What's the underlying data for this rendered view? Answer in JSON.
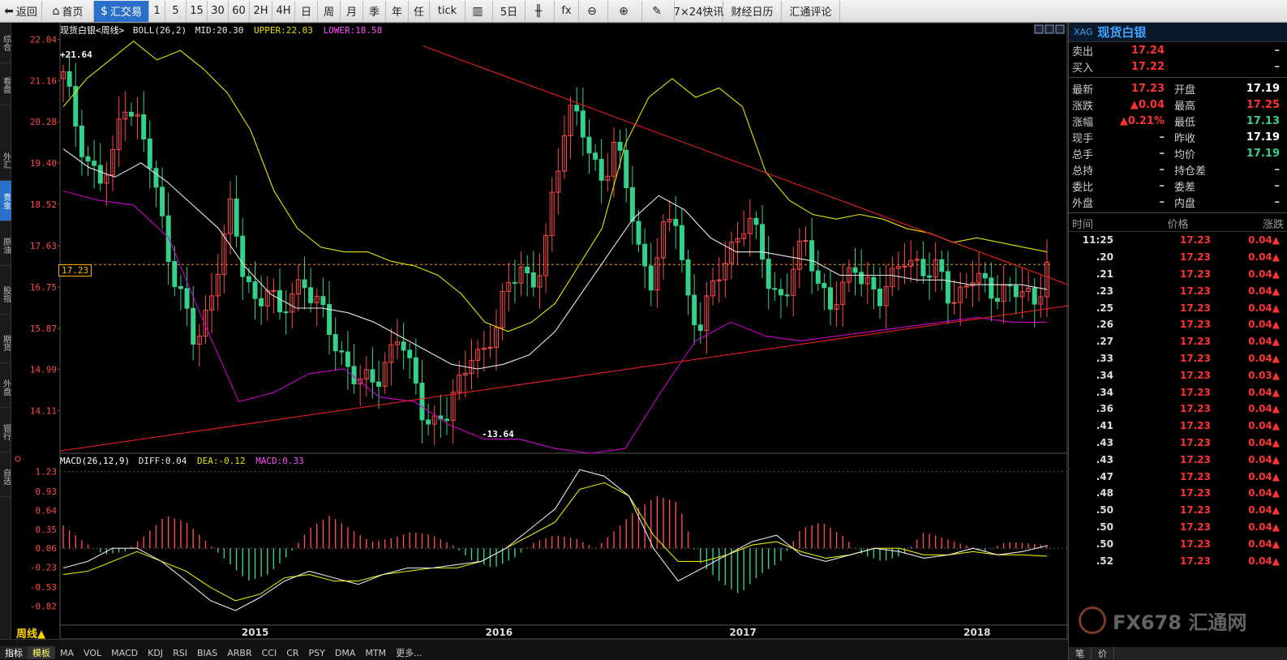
{
  "toolbar": {
    "items": [
      "返回",
      "首页",
      "汇交易",
      "1",
      "5",
      "15",
      "30",
      "60",
      "2H",
      "4H",
      "日",
      "周",
      "月",
      "季",
      "年",
      "任",
      "tick",
      "",
      "5日",
      "",
      "fx",
      "",
      "",
      "",
      "7×24快讯",
      "财经日历",
      "汇通评论"
    ]
  },
  "left_tabs": [
    "综合",
    "看盘",
    "外汇",
    "贵金",
    "原油",
    "股指",
    "期货",
    "外盘",
    "银行",
    "自选"
  ],
  "chart": {
    "title": "现货白银<周线>",
    "boll_label": "BOLL(26,2)",
    "mid_label": "MID:20.30",
    "upper_label": "UPPER:22.03",
    "lower_label": "LOWER:18.58",
    "macd_label": "MACD(26,12,9)",
    "diff_label": "DIFF:0.04",
    "dea_label": "DEA:-0.12",
    "macdv_label": "MACD:0.33",
    "high_mark": "+21.64",
    "low_mark": "-13.64",
    "current_price_tag": "17.23",
    "period": "周线▲"
  },
  "chart_data": {
    "type": "candlestick",
    "price_axis": [
      22.04,
      21.16,
      20.28,
      19.4,
      18.52,
      17.63,
      16.75,
      15.87,
      14.99,
      14.11
    ],
    "macd_axis": [
      1.23,
      0.93,
      0.64,
      0.35,
      0.06,
      -0.23,
      -0.53,
      -0.82
    ],
    "x_labels": [
      "2015",
      "2016",
      "2017",
      "2018"
    ],
    "price_ylim": [
      13.2,
      22.1
    ],
    "macd_ylim": [
      -1.1,
      1.3
    ],
    "close_trend": [
      21.2,
      20.3,
      19.5,
      19.0,
      19.2,
      20.9,
      20.4,
      19.6,
      18.4,
      17.3,
      16.4,
      15.4,
      16.2,
      17.5,
      18.4,
      17.0,
      16.5,
      16.8,
      16.0,
      16.6,
      17.0,
      16.4,
      15.9,
      15.4,
      15.0,
      14.6,
      14.7,
      15.3,
      15.8,
      14.8,
      14.1,
      13.9,
      14.0,
      14.6,
      15.5,
      15.3,
      15.7,
      16.8,
      17.4,
      16.6,
      17.2,
      19.2,
      20.5,
      20.3,
      19.4,
      19.2,
      19.8,
      18.8,
      17.5,
      17.0,
      17.8,
      18.3,
      16.6,
      15.9,
      16.5,
      17.3,
      17.8,
      18.2,
      17.6,
      16.8,
      16.5,
      17.2,
      17.7,
      16.9,
      16.3,
      16.6,
      17.3,
      16.9,
      16.4,
      16.8,
      17.6,
      17.2,
      16.9,
      17.2,
      16.6,
      16.5,
      17.0,
      16.8,
      16.7,
      16.5,
      16.7,
      16.5,
      17.23
    ],
    "upper_band": [
      20.6,
      21.2,
      21.6,
      22.0,
      21.6,
      21.8,
      21.4,
      20.9,
      20.1,
      18.8,
      18.0,
      17.6,
      17.5,
      17.5,
      17.3,
      17.2,
      17.0,
      16.6,
      16.0,
      15.8,
      16.0,
      16.4,
      17.2,
      18.0,
      19.8,
      20.8,
      21.2,
      20.8,
      21.0,
      20.6,
      19.2,
      18.6,
      18.3,
      18.2,
      18.3,
      18.2,
      18.0,
      17.9,
      17.7,
      17.8,
      17.7,
      17.6,
      17.5
    ],
    "mid_band": [
      19.7,
      19.3,
      19.1,
      19.4,
      19.0,
      18.5,
      18.0,
      17.2,
      16.6,
      16.3,
      16.3,
      16.2,
      16.0,
      15.7,
      15.4,
      15.1,
      15.0,
      15.1,
      15.3,
      15.8,
      16.6,
      17.4,
      18.2,
      18.7,
      18.4,
      17.8,
      17.5,
      17.5,
      17.4,
      17.3,
      17.0,
      17.0,
      17.0,
      16.9,
      16.9,
      16.8,
      16.8,
      16.8,
      16.7
    ],
    "lower_band": [
      18.8,
      18.6,
      18.5,
      17.8,
      16.0,
      14.3,
      14.5,
      14.9,
      15.0,
      14.4,
      14.3,
      13.8,
      13.5,
      13.5,
      13.3,
      13.2,
      13.3,
      14.5,
      15.6,
      16.0,
      15.7,
      15.6,
      15.7,
      15.8,
      15.9,
      16.0,
      16.1,
      16.0,
      16.0
    ],
    "trend_line_upper": {
      "from": [
        0.36,
        21.9
      ],
      "to": [
        1.0,
        16.8
      ]
    },
    "trend_line_lower": {
      "from": [
        0.0,
        13.25
      ],
      "to": [
        1.0,
        16.35
      ]
    },
    "macd_hist": [
      0.35,
      0.1,
      -0.1,
      -0.05,
      0.2,
      0.5,
      0.4,
      0.1,
      -0.2,
      -0.5,
      -0.4,
      -0.1,
      0.3,
      0.5,
      0.3,
      0.1,
      0.15,
      0.25,
      0.2,
      0.05,
      -0.2,
      -0.3,
      -0.15,
      0.1,
      0.2,
      0.15,
      0.0,
      0.3,
      0.6,
      0.8,
      0.7,
      -0.2,
      -0.5,
      -0.7,
      -0.4,
      -0.2,
      0.3,
      0.4,
      0.2,
      -0.1,
      -0.2,
      -0.1,
      0.25,
      0.15,
      0.05,
      -0.05,
      0.1,
      0.08,
      0.05
    ],
    "diff_line": [
      -0.3,
      -0.2,
      0.0,
      0.0,
      -0.2,
      -0.5,
      -0.8,
      -0.95,
      -0.75,
      -0.5,
      -0.35,
      -0.45,
      -0.55,
      -0.4,
      -0.3,
      -0.3,
      -0.25,
      -0.2,
      0.0,
      0.3,
      0.6,
      1.2,
      1.1,
      0.8,
      0.0,
      -0.5,
      -0.3,
      -0.1,
      0.1,
      0.2,
      -0.1,
      -0.2,
      -0.1,
      0.0,
      -0.05,
      -0.15,
      -0.1,
      0.0,
      -0.1,
      -0.05,
      0.04
    ],
    "dea_line": [
      -0.4,
      -0.35,
      -0.2,
      -0.05,
      -0.2,
      -0.35,
      -0.6,
      -0.8,
      -0.7,
      -0.45,
      -0.4,
      -0.5,
      -0.5,
      -0.4,
      -0.35,
      -0.3,
      -0.3,
      -0.2,
      0.0,
      0.2,
      0.4,
      0.9,
      1.0,
      0.8,
      0.2,
      -0.2,
      -0.2,
      -0.1,
      0.05,
      0.1,
      -0.05,
      -0.15,
      -0.1,
      0.0,
      0.0,
      -0.1,
      -0.1,
      -0.05,
      -0.1,
      -0.1,
      -0.12
    ],
    "colors": {
      "up": "#ff4a4a",
      "down": "#35d08a",
      "upper": "#e5e500",
      "mid": "#e8e8e8",
      "lower": "#d000d0",
      "trend": "#ff2020",
      "diff": "#e8e8e8",
      "dea": "#e5e500"
    }
  },
  "quote": {
    "code": "XAG",
    "name": "现货白银",
    "rows": [
      {
        "l1": "卖出",
        "v1": "17.24",
        "c1": "#ff3333",
        "l2": "",
        "v2": "–",
        "c2": "#ccc"
      },
      {
        "l1": "买入",
        "v1": "17.22",
        "c1": "#ff3333",
        "l2": "",
        "v2": "–",
        "c2": "#ccc"
      }
    ],
    "rows2": [
      {
        "l1": "最新",
        "v1": "17.23",
        "c1": "#ff3333",
        "l2": "开盘",
        "v2": "17.19",
        "c2": "#ffffff"
      },
      {
        "l1": "涨跌",
        "v1": "▲0.04",
        "c1": "#ff3333",
        "l2": "最高",
        "v2": "17.25",
        "c2": "#ff3333"
      },
      {
        "l1": "涨幅",
        "v1": "▲0.21%",
        "c1": "#ff3333",
        "l2": "最低",
        "v2": "17.13",
        "c2": "#35d08a"
      },
      {
        "l1": "现手",
        "v1": "–",
        "c1": "#ccc",
        "l2": "昨收",
        "v2": "17.19",
        "c2": "#ffffff"
      },
      {
        "l1": "总手",
        "v1": "–",
        "c1": "#ccc",
        "l2": "均价",
        "v2": "17.19",
        "c2": "#35d08a"
      },
      {
        "l1": "总持",
        "v1": "–",
        "c1": "#ccc",
        "l2": "持仓差",
        "v2": "–",
        "c2": "#ccc"
      },
      {
        "l1": "委比",
        "v1": "–",
        "c1": "#ccc",
        "l2": "委差",
        "v2": "–",
        "c2": "#ccc"
      },
      {
        "l1": "外盘",
        "v1": "–",
        "c1": "#ccc",
        "l2": "内盘",
        "v2": "–",
        "c2": "#ccc"
      }
    ],
    "ticks_head": [
      "时间",
      "价格",
      "涨跌"
    ],
    "ticks": [
      {
        "t": "11:25",
        "p": "17.23",
        "c": "0.04▲"
      },
      {
        "t": ".20",
        "p": "17.23",
        "c": "0.04▲"
      },
      {
        "t": ".21",
        "p": "17.23",
        "c": "0.04▲"
      },
      {
        "t": ".23",
        "p": "17.23",
        "c": "0.04▲"
      },
      {
        "t": ".25",
        "p": "17.23",
        "c": "0.04▲"
      },
      {
        "t": ".26",
        "p": "17.23",
        "c": "0.04▲"
      },
      {
        "t": ".27",
        "p": "17.23",
        "c": "0.04▲"
      },
      {
        "t": ".33",
        "p": "17.23",
        "c": "0.04▲"
      },
      {
        "t": ".34",
        "p": "17.23",
        "c": "0.03▲"
      },
      {
        "t": ".34",
        "p": "17.23",
        "c": "0.04▲"
      },
      {
        "t": ".36",
        "p": "17.23",
        "c": "0.04▲"
      },
      {
        "t": ".41",
        "p": "17.23",
        "c": "0.04▲"
      },
      {
        "t": ".43",
        "p": "17.23",
        "c": "0.04▲"
      },
      {
        "t": ".43",
        "p": "17.23",
        "c": "0.04▲"
      },
      {
        "t": ".47",
        "p": "17.23",
        "c": "0.04▲"
      },
      {
        "t": ".48",
        "p": "17.23",
        "c": "0.04▲"
      },
      {
        "t": ".50",
        "p": "17.23",
        "c": "0.04▲"
      },
      {
        "t": ".50",
        "p": "17.23",
        "c": "0.04▲"
      },
      {
        "t": ".50",
        "p": "17.23",
        "c": "0.04▲"
      },
      {
        "t": ".52",
        "p": "17.23",
        "c": "0.04▲"
      }
    ],
    "bottom_tabs": [
      "笔",
      "价"
    ]
  },
  "bottom": {
    "tabs": [
      "指标",
      "模板",
      "MA",
      "VOL",
      "MACD",
      "KDJ",
      "RSI",
      "BIAS",
      "ARBR",
      "CCI",
      "CR",
      "PSY",
      "DMA",
      "MTM",
      "更多..."
    ]
  },
  "watermark": "FX678 汇通网"
}
